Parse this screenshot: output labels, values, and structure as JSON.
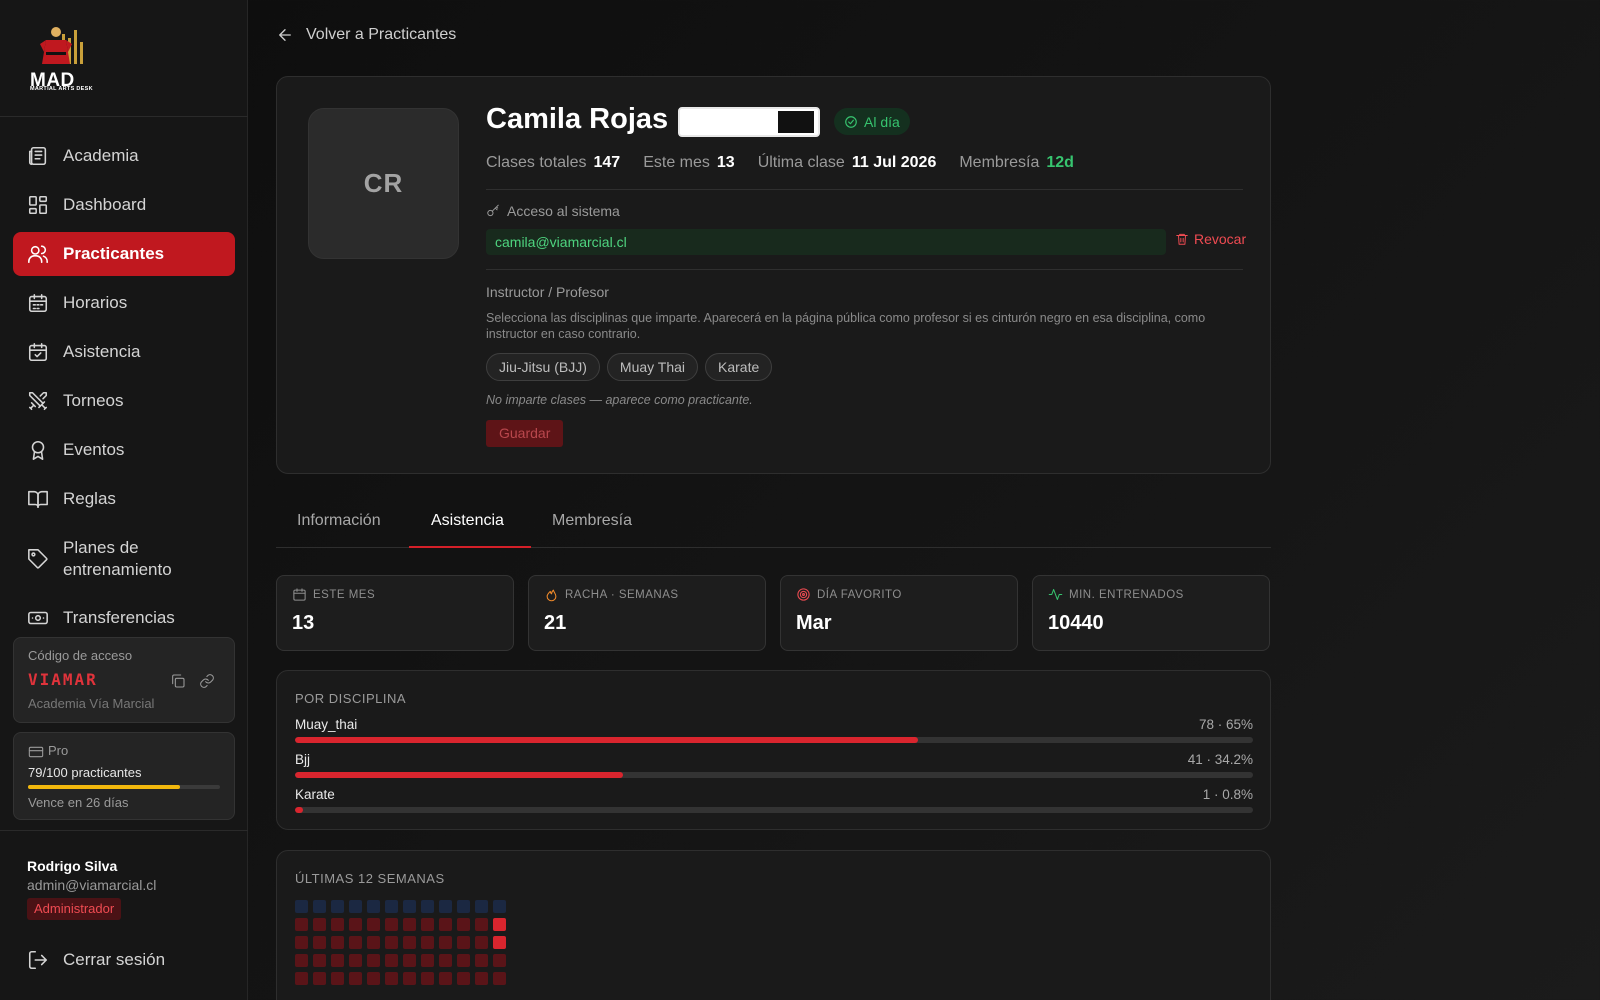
{
  "sidebar": {
    "logo": {
      "text": "MAD",
      "subtitle": "MARTIAL ARTS DESK"
    },
    "items": [
      {
        "label": "Academia",
        "icon": "newspaper-icon"
      },
      {
        "label": "Dashboard",
        "icon": "dashboard-grid-icon"
      },
      {
        "label": "Practicantes",
        "icon": "users-icon",
        "active": true
      },
      {
        "label": "Horarios",
        "icon": "calendar-icon"
      },
      {
        "label": "Asistencia",
        "icon": "calendar-check-icon"
      },
      {
        "label": "Torneos",
        "icon": "swords-icon"
      },
      {
        "label": "Eventos",
        "icon": "award-icon"
      },
      {
        "label": "Reglas",
        "icon": "book-icon"
      },
      {
        "label": "Planes de entrenamiento",
        "icon": "tag-icon"
      },
      {
        "label": "Transferencias",
        "icon": "banknote-icon"
      }
    ],
    "access_code": {
      "label": "Código de acceso",
      "value": "VIAMAR",
      "academy": "Academia Vía Marcial"
    },
    "plan": {
      "name": "Pro",
      "count_text": "79/100 practicantes",
      "usage_fraction": 0.79,
      "expiry": "Vence en 26 días"
    },
    "user": {
      "name": "Rodrigo Silva",
      "email": "admin@viamarcial.cl",
      "role": "Administrador"
    },
    "logout": "Cerrar sesión"
  },
  "back_link": "Volver a Practicantes",
  "profile": {
    "initials": "CR",
    "name": "Camila Rojas",
    "status": "Al día",
    "stats": [
      {
        "label": "Clases totales",
        "value": "147"
      },
      {
        "label": "Este mes",
        "value": "13"
      },
      {
        "label": "Última clase",
        "value": "11 Jul 2026"
      },
      {
        "label": "Membresía",
        "value": "12d"
      }
    ],
    "system_access_label": "Acceso al sistema",
    "email": "camila@viamarcial.cl",
    "revoke_label": "Revocar",
    "instructor_title": "Instructor / Profesor",
    "instructor_desc": "Selecciona las disciplinas que imparte. Aparecerá en la página pública como profesor si es cinturón negro en esa disciplina, como instructor en caso contrario.",
    "disciplines": [
      "Jiu-Jitsu (BJJ)",
      "Muay Thai",
      "Karate"
    ],
    "note": "No imparte clases — aparece como practicante.",
    "save_label": "Guardar"
  },
  "tabs": [
    {
      "label": "Información"
    },
    {
      "label": "Asistencia",
      "active": true
    },
    {
      "label": "Membresía"
    }
  ],
  "stat_cards": [
    {
      "label": "ESTE MES",
      "value": "13",
      "icon": "calendar-icon",
      "color": "#8e8e8e"
    },
    {
      "label": "RACHA · SEMANAS",
      "value": "21",
      "icon": "flame-icon",
      "color": "#f08a2a"
    },
    {
      "label": "DÍA FAVORITO",
      "value": "Mar",
      "icon": "target-icon",
      "color": "#ef4b52"
    },
    {
      "label": "MIN. ENTRENADOS",
      "value": "10440",
      "icon": "activity-icon",
      "color": "#37c46f"
    }
  ],
  "by_discipline": {
    "title": "POR DISCIPLINA",
    "rows": [
      {
        "name": "Muay_thai",
        "value_text": "78 · 65%",
        "fraction": 0.65
      },
      {
        "name": "Bjj",
        "value_text": "41 · 34.2%",
        "fraction": 0.342
      },
      {
        "name": "Karate",
        "value_text": "1 · 0.8%",
        "fraction": 0.008
      }
    ]
  },
  "weeks": {
    "title": "ÚLTIMAS 12 SEMANAS",
    "columns": 12,
    "visible_rows": 5
  }
}
